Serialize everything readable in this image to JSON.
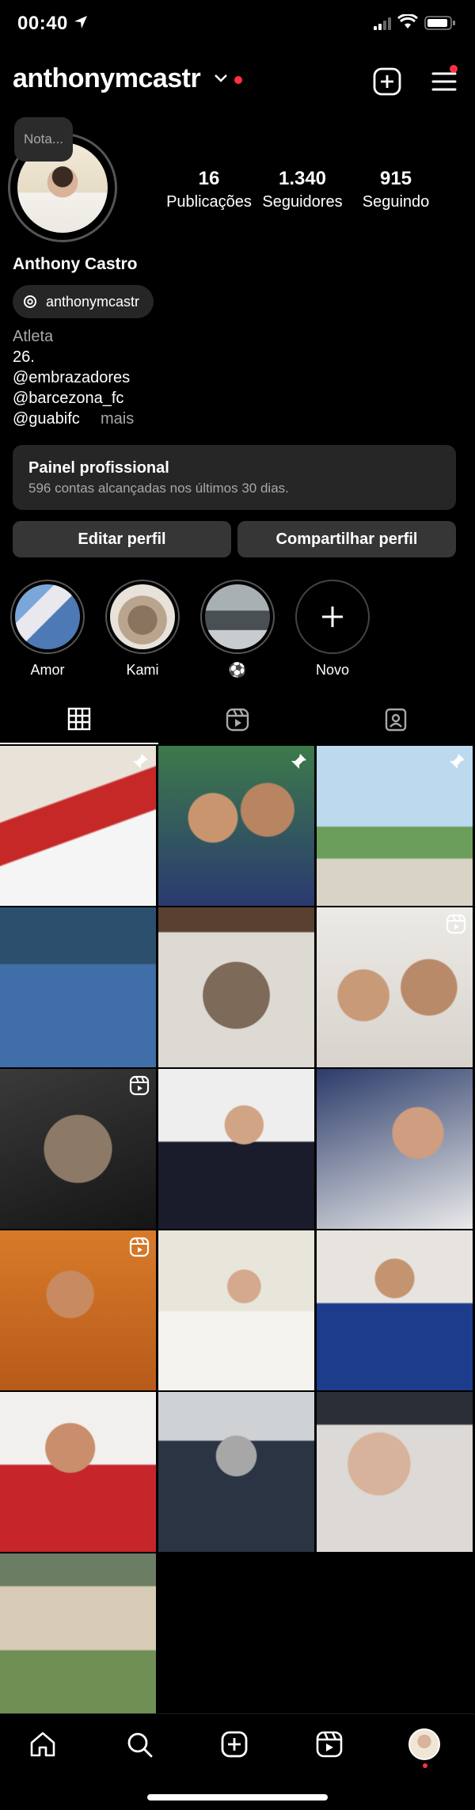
{
  "status_bar": {
    "time": "00:40"
  },
  "header": {
    "username": "anthonymcastr"
  },
  "profile": {
    "note": "Nota...",
    "stats": [
      {
        "value": "16",
        "label": "Publicações"
      },
      {
        "value": "1.340",
        "label": "Seguidores"
      },
      {
        "value": "915",
        "label": "Seguindo"
      }
    ],
    "full_name": "Anthony Castro",
    "threads_handle": "anthonymcastr",
    "category": "Atleta",
    "bio_lines": [
      "26.",
      "@embrazadores",
      "@barcezona_fc",
      "@guabifc"
    ],
    "more_label": "mais"
  },
  "pro_panel": {
    "title": "Painel profissional",
    "subtitle": "596 contas alcançadas nos últimos 30 dias."
  },
  "buttons": {
    "edit": "Editar perfil",
    "share": "Compartilhar perfil"
  },
  "highlights": [
    {
      "label": "Amor"
    },
    {
      "label": "Kami"
    },
    {
      "label": "⚽"
    },
    {
      "label": "Novo"
    }
  ],
  "tabs": [
    "grid-icon",
    "reels-icon",
    "tagged-icon"
  ],
  "grid": [
    {
      "badge": "pin"
    },
    {
      "badge": "pin"
    },
    {
      "badge": "pin"
    },
    {
      "badge": ""
    },
    {
      "badge": ""
    },
    {
      "badge": "reel"
    },
    {
      "badge": "reel"
    },
    {
      "badge": ""
    },
    {
      "badge": ""
    },
    {
      "badge": "reel"
    },
    {
      "badge": ""
    },
    {
      "badge": ""
    },
    {
      "badge": ""
    },
    {
      "badge": ""
    },
    {
      "badge": ""
    },
    {
      "badge": ""
    }
  ],
  "colors": {
    "background": "#000000",
    "surface": "#262626",
    "button": "#363636",
    "muted": "#a8a8a8",
    "notification": "#ff3040"
  },
  "bottom_nav": [
    "home-icon",
    "search-icon",
    "create-icon",
    "reels-icon",
    "profile-avatar"
  ]
}
